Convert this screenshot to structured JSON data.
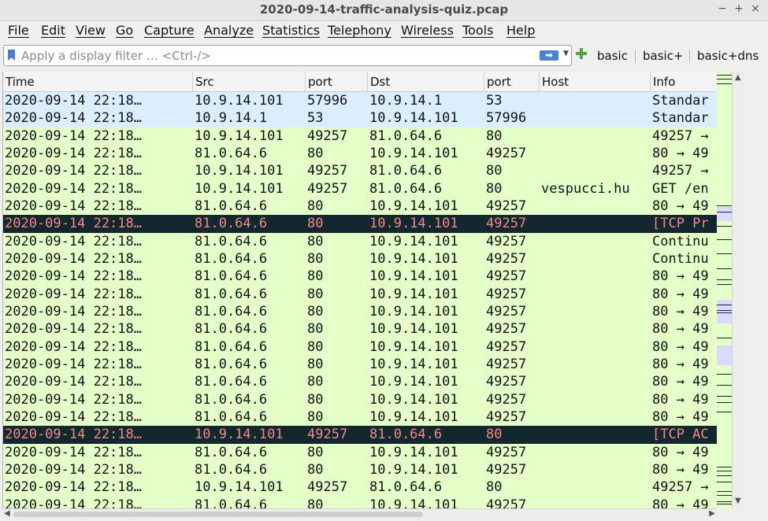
{
  "window": {
    "title": "2020-09-14-traffic-analysis-quiz.pcap",
    "controls": [
      "−",
      "+",
      "×"
    ]
  },
  "menu": [
    "File",
    "Edit",
    "View",
    "Go",
    "Capture",
    "Analyze",
    "Statistics",
    "Telephony",
    "Wireless",
    "Tools",
    "Help"
  ],
  "filter": {
    "placeholder": "Apply a display filter … <Ctrl-/>",
    "value": "",
    "buttons": [
      "basic",
      "basic+",
      "basic+dns"
    ]
  },
  "columns": [
    "Time",
    "Src",
    "port",
    "Dst",
    "port",
    "Host",
    "Info"
  ],
  "colors": {
    "dns": "#daeeff",
    "tcp": "#e4ffc7",
    "bad_bg": "#12272e",
    "bad_fg": "#f78787"
  },
  "rows": [
    {
      "time": "2020-09-14 22:18…",
      "src": "10.9.14.101",
      "sport": "57996",
      "dst": "10.9.14.1",
      "dport": "53",
      "host": "",
      "info": "Standar",
      "type": "dns"
    },
    {
      "time": "2020-09-14 22:18…",
      "src": "10.9.14.1",
      "sport": "53",
      "dst": "10.9.14.101",
      "dport": "57996",
      "host": "",
      "info": "Standar",
      "type": "dns"
    },
    {
      "time": "2020-09-14 22:18…",
      "src": "10.9.14.101",
      "sport": "49257",
      "dst": "81.0.64.6",
      "dport": "80",
      "host": "",
      "info": "49257 →",
      "type": "tcp"
    },
    {
      "time": "2020-09-14 22:18…",
      "src": "81.0.64.6",
      "sport": "80",
      "dst": "10.9.14.101",
      "dport": "49257",
      "host": "",
      "info": "80 → 49",
      "type": "tcp"
    },
    {
      "time": "2020-09-14 22:18…",
      "src": "10.9.14.101",
      "sport": "49257",
      "dst": "81.0.64.6",
      "dport": "80",
      "host": "",
      "info": "49257 →",
      "type": "tcp"
    },
    {
      "time": "2020-09-14 22:18…",
      "src": "10.9.14.101",
      "sport": "49257",
      "dst": "81.0.64.6",
      "dport": "80",
      "host": "vespucci.hu",
      "info": "GET /en",
      "type": "tcp"
    },
    {
      "time": "2020-09-14 22:18…",
      "src": "81.0.64.6",
      "sport": "80",
      "dst": "10.9.14.101",
      "dport": "49257",
      "host": "",
      "info": "80 → 49",
      "type": "tcp"
    },
    {
      "time": "2020-09-14 22:18…",
      "src": "81.0.64.6",
      "sport": "80",
      "dst": "10.9.14.101",
      "dport": "49257",
      "host": "",
      "info": "[TCP Pr",
      "type": "bad"
    },
    {
      "time": "2020-09-14 22:18…",
      "src": "81.0.64.6",
      "sport": "80",
      "dst": "10.9.14.101",
      "dport": "49257",
      "host": "",
      "info": "Continu",
      "type": "tcp"
    },
    {
      "time": "2020-09-14 22:18…",
      "src": "81.0.64.6",
      "sport": "80",
      "dst": "10.9.14.101",
      "dport": "49257",
      "host": "",
      "info": "Continu",
      "type": "tcp"
    },
    {
      "time": "2020-09-14 22:18…",
      "src": "81.0.64.6",
      "sport": "80",
      "dst": "10.9.14.101",
      "dport": "49257",
      "host": "",
      "info": "80 → 49",
      "type": "tcp"
    },
    {
      "time": "2020-09-14 22:18…",
      "src": "81.0.64.6",
      "sport": "80",
      "dst": "10.9.14.101",
      "dport": "49257",
      "host": "",
      "info": "80 → 49",
      "type": "tcp"
    },
    {
      "time": "2020-09-14 22:18…",
      "src": "81.0.64.6",
      "sport": "80",
      "dst": "10.9.14.101",
      "dport": "49257",
      "host": "",
      "info": "80 → 49",
      "type": "tcp"
    },
    {
      "time": "2020-09-14 22:18…",
      "src": "81.0.64.6",
      "sport": "80",
      "dst": "10.9.14.101",
      "dport": "49257",
      "host": "",
      "info": "80 → 49",
      "type": "tcp"
    },
    {
      "time": "2020-09-14 22:18…",
      "src": "81.0.64.6",
      "sport": "80",
      "dst": "10.9.14.101",
      "dport": "49257",
      "host": "",
      "info": "80 → 49",
      "type": "tcp"
    },
    {
      "time": "2020-09-14 22:18…",
      "src": "81.0.64.6",
      "sport": "80",
      "dst": "10.9.14.101",
      "dport": "49257",
      "host": "",
      "info": "80 → 49",
      "type": "tcp"
    },
    {
      "time": "2020-09-14 22:18…",
      "src": "81.0.64.6",
      "sport": "80",
      "dst": "10.9.14.101",
      "dport": "49257",
      "host": "",
      "info": "80 → 49",
      "type": "tcp"
    },
    {
      "time": "2020-09-14 22:18…",
      "src": "81.0.64.6",
      "sport": "80",
      "dst": "10.9.14.101",
      "dport": "49257",
      "host": "",
      "info": "80 → 49",
      "type": "tcp"
    },
    {
      "time": "2020-09-14 22:18…",
      "src": "81.0.64.6",
      "sport": "80",
      "dst": "10.9.14.101",
      "dport": "49257",
      "host": "",
      "info": "80 → 49",
      "type": "tcp"
    },
    {
      "time": "2020-09-14 22:18…",
      "src": "10.9.14.101",
      "sport": "49257",
      "dst": "81.0.64.6",
      "dport": "80",
      "host": "",
      "info": "[TCP AC",
      "type": "bad"
    },
    {
      "time": "2020-09-14 22:18…",
      "src": "81.0.64.6",
      "sport": "80",
      "dst": "10.9.14.101",
      "dport": "49257",
      "host": "",
      "info": "80 → 49",
      "type": "tcp"
    },
    {
      "time": "2020-09-14 22:18…",
      "src": "81.0.64.6",
      "sport": "80",
      "dst": "10.9.14.101",
      "dport": "49257",
      "host": "",
      "info": "80 → 49",
      "type": "tcp"
    },
    {
      "time": "2020-09-14 22:18…",
      "src": "10.9.14.101",
      "sport": "49257",
      "dst": "81.0.64.6",
      "dport": "80",
      "host": "",
      "info": "49257 →",
      "type": "tcp"
    },
    {
      "time": "2020-09-14 22:18…",
      "src": "81.0.64.6",
      "sport": "80",
      "dst": "10.9.14.101",
      "dport": "49257",
      "host": "",
      "info": "80 → 49",
      "type": "tcp"
    }
  ]
}
